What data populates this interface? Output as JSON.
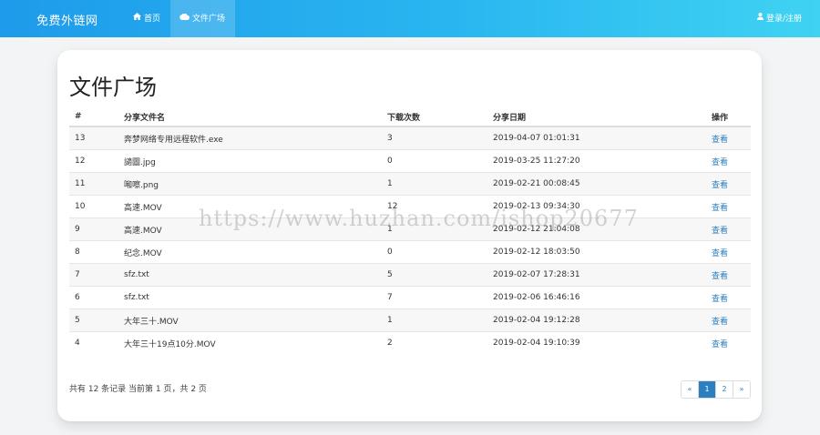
{
  "nav": {
    "brand": "免费外链网",
    "home_label": "首页",
    "files_label": "文件广场",
    "login_label": "登录/注册"
  },
  "page": {
    "title": "文件广场"
  },
  "table": {
    "headers": [
      "#",
      "分享文件名",
      "下载次数",
      "分享日期",
      "操作"
    ],
    "rows": [
      {
        "id": "13",
        "name": "奔梦网络专用远程软件.exe",
        "downloads": "3",
        "date": "2019-04-07 01:01:31",
        "action": "查看"
      },
      {
        "id": "12",
        "name": "讁圖.jpg",
        "downloads": "0",
        "date": "2019-03-25 11:27:20",
        "action": "查看"
      },
      {
        "id": "11",
        "name": "啝嚓.png",
        "downloads": "1",
        "date": "2019-02-21 00:08:45",
        "action": "查看"
      },
      {
        "id": "10",
        "name": "高速.MOV",
        "downloads": "12",
        "date": "2019-02-13 09:34:30",
        "action": "查看"
      },
      {
        "id": "9",
        "name": "高速.MOV",
        "downloads": "1",
        "date": "2019-02-12 21:04:08",
        "action": "查看"
      },
      {
        "id": "8",
        "name": "纪念.MOV",
        "downloads": "0",
        "date": "2019-02-12 18:03:50",
        "action": "查看"
      },
      {
        "id": "7",
        "name": "sfz.txt",
        "downloads": "5",
        "date": "2019-02-07 17:28:31",
        "action": "查看"
      },
      {
        "id": "6",
        "name": "sfz.txt",
        "downloads": "7",
        "date": "2019-02-06 16:46:16",
        "action": "查看"
      },
      {
        "id": "5",
        "name": "大年三十.MOV",
        "downloads": "1",
        "date": "2019-02-04 19:12:28",
        "action": "查看"
      },
      {
        "id": "4",
        "name": "大年三十19点10分.MOV",
        "downloads": "2",
        "date": "2019-02-04 19:10:39",
        "action": "查看"
      }
    ]
  },
  "footer": {
    "summary": "共有 12 条记录  当前第 1 页，共 2 页"
  },
  "pagination": {
    "prev": "«",
    "pages": [
      "1",
      "2"
    ],
    "current": "1",
    "next": "»"
  },
  "watermark": "https://www.huzhan.com/ishop20677",
  "colors": {
    "nav_start": "#1e9bea",
    "nav_end": "#3fd3f2",
    "link": "#2a7fc1"
  },
  "icons": {
    "home": "home-icon",
    "files": "cloud-icon",
    "login": "user-icon"
  }
}
